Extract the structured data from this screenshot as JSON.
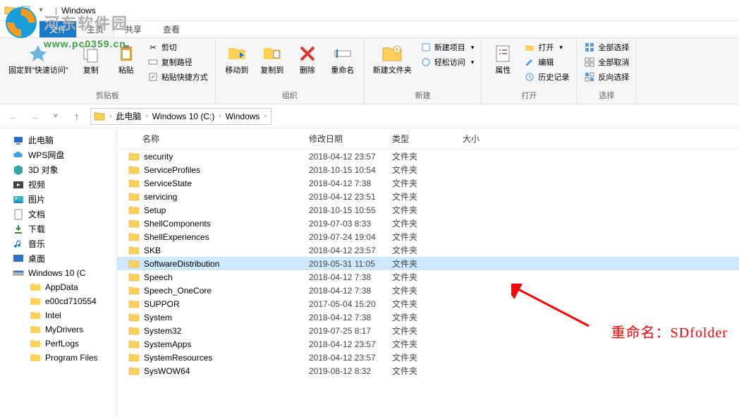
{
  "window": {
    "title": "Windows"
  },
  "watermark": {
    "title": "河东软件园",
    "url": "www.pc0359.cn"
  },
  "tabs": {
    "file": "文件",
    "home": "主页",
    "share": "共享",
    "view": "查看"
  },
  "ribbon": {
    "clipboard": {
      "label": "剪贴板",
      "pin": "固定到\"快速访问\"",
      "copy": "复制",
      "paste": "粘贴",
      "cut": "剪切",
      "copy_path": "复制路径",
      "paste_shortcut": "粘贴快捷方式"
    },
    "organize": {
      "label": "组织",
      "move_to": "移动到",
      "copy_to": "复制到",
      "delete": "删除",
      "rename": "重命名"
    },
    "new": {
      "label": "新建",
      "new_folder": "新建文件夹",
      "new_item": "新建项目",
      "easy_access": "轻松访问"
    },
    "open": {
      "label": "打开",
      "properties": "属性",
      "open": "打开",
      "edit": "编辑",
      "history": "历史记录"
    },
    "select": {
      "label": "选择",
      "select_all": "全部选择",
      "select_none": "全部取消",
      "invert": "反向选择"
    }
  },
  "breadcrumb": {
    "pc": "此电脑",
    "drive": "Windows 10 (C:)",
    "folder": "Windows"
  },
  "columns": {
    "name": "名称",
    "date": "修改日期",
    "type": "类型",
    "size": "大小"
  },
  "nav": {
    "this_pc": "此电脑",
    "wps": "WPS网盘",
    "objects3d": "3D 对象",
    "videos": "视频",
    "pictures": "图片",
    "documents": "文档",
    "downloads": "下载",
    "music": "音乐",
    "desktop": "桌面",
    "drive_c": "Windows 10 (C",
    "appdata": "AppData",
    "e00": "e00cd710554",
    "intel": "Intel",
    "mydrivers": "MyDrivers",
    "perflogs": "PerfLogs",
    "program_files": "Program Files"
  },
  "files": [
    {
      "name": "security",
      "date": "2018-04-12 23:57",
      "type": "文件夹",
      "selected": false
    },
    {
      "name": "ServiceProfiles",
      "date": "2018-10-15 10:54",
      "type": "文件夹",
      "selected": false
    },
    {
      "name": "ServiceState",
      "date": "2018-04-12 7:38",
      "type": "文件夹",
      "selected": false
    },
    {
      "name": "servicing",
      "date": "2018-04-12 23:51",
      "type": "文件夹",
      "selected": false
    },
    {
      "name": "Setup",
      "date": "2018-10-15 10:55",
      "type": "文件夹",
      "selected": false
    },
    {
      "name": "ShellComponents",
      "date": "2019-07-03 8:33",
      "type": "文件夹",
      "selected": false
    },
    {
      "name": "ShellExperiences",
      "date": "2019-07-24 19:04",
      "type": "文件夹",
      "selected": false
    },
    {
      "name": "SKB",
      "date": "2018-04-12 23:57",
      "type": "文件夹",
      "selected": false
    },
    {
      "name": "SoftwareDistribution",
      "date": "2019-05-31 11:05",
      "type": "文件夹",
      "selected": true
    },
    {
      "name": "Speech",
      "date": "2018-04-12 7:38",
      "type": "文件夹",
      "selected": false
    },
    {
      "name": "Speech_OneCore",
      "date": "2018-04-12 7:38",
      "type": "文件夹",
      "selected": false
    },
    {
      "name": "SUPPOR",
      "date": "2017-05-04 15:20",
      "type": "文件夹",
      "selected": false
    },
    {
      "name": "System",
      "date": "2018-04-12 7:38",
      "type": "文件夹",
      "selected": false
    },
    {
      "name": "System32",
      "date": "2019-07-25 8:17",
      "type": "文件夹",
      "selected": false
    },
    {
      "name": "SystemApps",
      "date": "2018-04-12 23:57",
      "type": "文件夹",
      "selected": false
    },
    {
      "name": "SystemResources",
      "date": "2018-04-12 23:57",
      "type": "文件夹",
      "selected": false
    },
    {
      "name": "SysWOW64",
      "date": "2019-08-12 8:32",
      "type": "文件夹",
      "selected": false
    }
  ],
  "annotation": {
    "text": "重命名：SDfolder"
  }
}
